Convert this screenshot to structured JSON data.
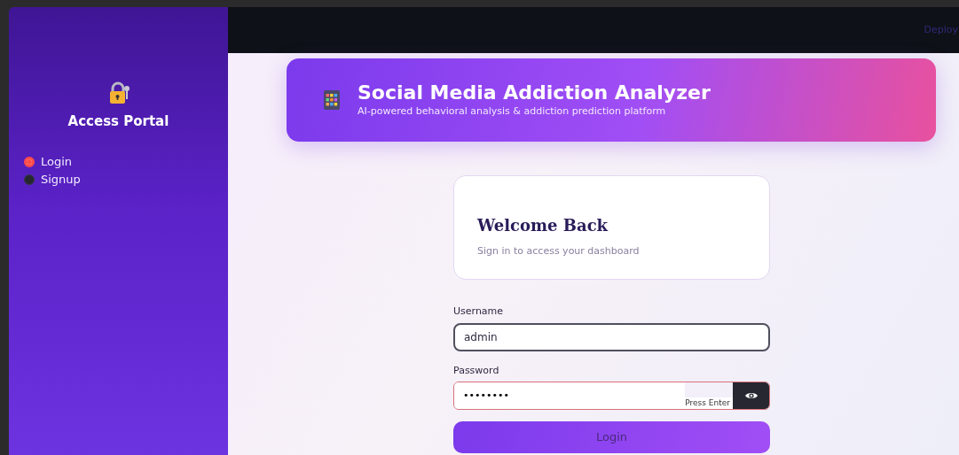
{
  "sidebar": {
    "title": "Access Portal",
    "options": [
      {
        "label": "Login",
        "selected": true
      },
      {
        "label": "Signup",
        "selected": false
      }
    ]
  },
  "header": {
    "action": "Deploy"
  },
  "banner": {
    "title": "Social Media Addiction Analyzer",
    "subtitle": "AI-powered behavioral analysis & addiction prediction platform"
  },
  "card": {
    "title": "Welcome Back",
    "subtitle": "Sign in to access your dashboard"
  },
  "form": {
    "username": {
      "label": "Username",
      "value": "admin"
    },
    "password": {
      "label": "Password",
      "value": "••••••••",
      "hint": "Press Enter"
    },
    "submit": "Login"
  }
}
